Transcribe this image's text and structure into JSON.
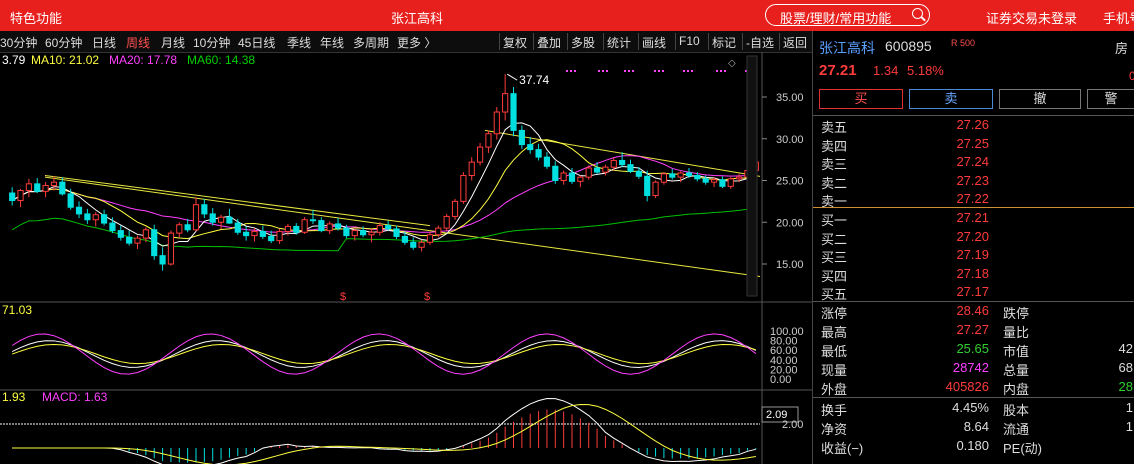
{
  "topbar": {
    "left_menu": "特色功能",
    "title": "张江高科",
    "search_placeholder": "股票/理财/常用功能",
    "login": "证券交易未登录",
    "mobile": "手机号"
  },
  "toolbar": {
    "periods": [
      "30分钟",
      "60分钟",
      "日线",
      "周线",
      "月线",
      "10分钟",
      "45日线",
      "季线",
      "年线",
      "多周期",
      "更多 〉"
    ],
    "active_period": "周线",
    "tools": [
      "复权",
      "叠加",
      "多股",
      "统计",
      "画线",
      "F10",
      "标记",
      "-自选",
      "返回"
    ]
  },
  "ma_legend": {
    "ma5": "3.79",
    "ma10": "MA10: 21.02",
    "ma20": "MA20: 17.78",
    "ma60": "MA60: 14.38"
  },
  "chart_data": {
    "type": "candlestick",
    "price_axis": [
      "35.00",
      "30.00",
      "25.00",
      "20.00",
      "15.00"
    ],
    "ylim": [
      12.5,
      37.74
    ],
    "peak_label": "37.74",
    "signal_marker": "$",
    "kdj_label": "71.03",
    "kdj_axis": [
      "100.00",
      "80.00",
      "60.00",
      "40.00",
      "20.00",
      "0.00"
    ],
    "macd_label_left": "1.93",
    "macd_label": "MACD: 1.63",
    "macd_axis_mark": "2.09",
    "macd_axis_tick": "2.00",
    "ohlc": [
      [
        23.5,
        24.2,
        22.0,
        22.6
      ],
      [
        22.6,
        24.0,
        21.8,
        23.8
      ],
      [
        23.8,
        25.2,
        23.0,
        24.6
      ],
      [
        24.6,
        25.3,
        23.5,
        23.7
      ],
      [
        23.7,
        24.8,
        23.0,
        24.4
      ],
      [
        24.4,
        25.5,
        23.8,
        24.8
      ],
      [
        24.8,
        25.4,
        23.2,
        23.4
      ],
      [
        23.4,
        24.0,
        21.5,
        21.8
      ],
      [
        21.8,
        22.5,
        20.5,
        21.0
      ],
      [
        21.0,
        21.6,
        19.8,
        20.3
      ],
      [
        20.3,
        21.2,
        19.5,
        20.9
      ],
      [
        20.9,
        21.5,
        19.6,
        19.9
      ],
      [
        19.9,
        20.6,
        18.7,
        19.0
      ],
      [
        19.0,
        19.6,
        17.8,
        18.2
      ],
      [
        18.2,
        19.0,
        17.2,
        17.5
      ],
      [
        17.5,
        18.4,
        16.8,
        18.1
      ],
      [
        18.1,
        19.4,
        17.6,
        19.1
      ],
      [
        19.1,
        19.7,
        15.5,
        16.0
      ],
      [
        16.0,
        17.0,
        14.2,
        15.0
      ],
      [
        15.0,
        19.0,
        14.8,
        18.7
      ],
      [
        18.7,
        20.0,
        18.2,
        19.7
      ],
      [
        19.7,
        20.4,
        18.8,
        19.1
      ],
      [
        19.1,
        23.0,
        18.9,
        22.1
      ],
      [
        22.1,
        22.8,
        20.5,
        21.0
      ],
      [
        21.0,
        21.7,
        19.6,
        20.0
      ],
      [
        20.0,
        20.9,
        19.2,
        20.6
      ],
      [
        20.6,
        21.6,
        19.8,
        19.9
      ],
      [
        19.9,
        20.4,
        18.5,
        18.8
      ],
      [
        18.8,
        19.5,
        17.8,
        18.4
      ],
      [
        18.4,
        19.3,
        17.7,
        18.9
      ],
      [
        18.9,
        19.6,
        18.0,
        18.3
      ],
      [
        18.3,
        19.0,
        17.5,
        17.8
      ],
      [
        17.8,
        19.2,
        17.4,
        18.9
      ],
      [
        18.9,
        19.8,
        18.4,
        19.5
      ],
      [
        19.5,
        19.9,
        18.5,
        18.8
      ],
      [
        18.8,
        20.6,
        18.6,
        20.3
      ],
      [
        20.3,
        21.5,
        19.8,
        20.2
      ],
      [
        20.2,
        20.6,
        18.8,
        19.0
      ],
      [
        19.0,
        20.1,
        18.6,
        19.8
      ],
      [
        19.8,
        20.5,
        19.0,
        19.3
      ],
      [
        19.3,
        19.7,
        18.1,
        18.4
      ],
      [
        18.4,
        19.3,
        17.8,
        19.0
      ],
      [
        19.0,
        19.5,
        18.2,
        18.5
      ],
      [
        18.5,
        19.2,
        17.6,
        18.8
      ],
      [
        18.8,
        20.0,
        18.4,
        19.6
      ],
      [
        19.6,
        20.2,
        19.0,
        19.2
      ],
      [
        19.2,
        19.6,
        18.0,
        18.3
      ],
      [
        18.3,
        18.9,
        17.3,
        17.6
      ],
      [
        17.6,
        18.2,
        16.7,
        17.0
      ],
      [
        17.0,
        17.9,
        16.5,
        17.6
      ],
      [
        17.6,
        18.8,
        17.3,
        18.5
      ],
      [
        18.5,
        19.6,
        18.2,
        19.3
      ],
      [
        19.3,
        21.0,
        19.0,
        20.7
      ],
      [
        20.7,
        22.8,
        20.3,
        22.5
      ],
      [
        22.5,
        26.0,
        22.2,
        25.6
      ],
      [
        25.6,
        27.8,
        25.0,
        27.2
      ],
      [
        27.2,
        29.5,
        26.8,
        29.0
      ],
      [
        29.0,
        31.0,
        28.3,
        30.6
      ],
      [
        30.6,
        33.8,
        29.9,
        33.2
      ],
      [
        33.2,
        37.74,
        32.2,
        35.4
      ],
      [
        35.4,
        36.2,
        30.3,
        31.0
      ],
      [
        31.0,
        31.6,
        28.8,
        29.3
      ],
      [
        29.3,
        30.2,
        28.2,
        28.7
      ],
      [
        28.7,
        29.4,
        27.4,
        27.8
      ],
      [
        27.8,
        28.4,
        26.4,
        26.7
      ],
      [
        26.7,
        27.3,
        24.6,
        25.0
      ],
      [
        25.0,
        26.2,
        24.5,
        25.9
      ],
      [
        25.9,
        26.5,
        24.6,
        24.9
      ],
      [
        24.9,
        25.6,
        24.2,
        25.4
      ],
      [
        25.4,
        26.8,
        25.1,
        26.5
      ],
      [
        26.5,
        27.2,
        25.8,
        26.0
      ],
      [
        26.0,
        26.9,
        25.6,
        26.6
      ],
      [
        26.6,
        27.7,
        26.2,
        27.4
      ],
      [
        27.4,
        28.4,
        26.6,
        26.9
      ],
      [
        26.9,
        27.5,
        25.9,
        26.1
      ],
      [
        26.1,
        26.6,
        25.2,
        25.5
      ],
      [
        25.5,
        26.2,
        22.5,
        23.2
      ],
      [
        23.2,
        25.0,
        22.9,
        24.8
      ],
      [
        24.8,
        26.0,
        24.5,
        25.8
      ],
      [
        25.8,
        26.4,
        25.1,
        25.4
      ],
      [
        25.4,
        26.1,
        24.8,
        25.9
      ],
      [
        25.9,
        26.5,
        25.3,
        25.6
      ],
      [
        25.6,
        26.0,
        24.9,
        25.2
      ],
      [
        25.2,
        25.6,
        24.5,
        24.8
      ],
      [
        24.8,
        25.4,
        24.2,
        25.1
      ],
      [
        25.1,
        25.5,
        24.1,
        24.3
      ],
      [
        24.3,
        25.4,
        24.0,
        25.2
      ],
      [
        25.2,
        25.8,
        24.8,
        25.4
      ],
      [
        25.4,
        26.5,
        25.2,
        26.2
      ],
      [
        26.2,
        27.4,
        26.0,
        27.21
      ]
    ]
  },
  "quote": {
    "name": "张江高科",
    "code": "600895",
    "tag": "R 500",
    "extra": "房",
    "price": "27.21",
    "change": "1.34",
    "percent": "5.18%",
    "zero": "0"
  },
  "trade_buttons": {
    "buy": "买",
    "sell": "卖",
    "cancel": "撤",
    "more": "警"
  },
  "order_book": {
    "sells": [
      {
        "label": "卖五",
        "price": "27.26"
      },
      {
        "label": "卖四",
        "price": "27.25"
      },
      {
        "label": "卖三",
        "price": "27.24"
      },
      {
        "label": "卖二",
        "price": "27.23"
      },
      {
        "label": "卖一",
        "price": "27.22"
      }
    ],
    "buys": [
      {
        "label": "买一",
        "price": "27.21"
      },
      {
        "label": "买二",
        "price": "27.20"
      },
      {
        "label": "买三",
        "price": "27.19"
      },
      {
        "label": "买四",
        "price": "27.18"
      },
      {
        "label": "买五",
        "price": "27.17"
      }
    ]
  },
  "stats": [
    {
      "k": "涨停",
      "v": "28.46",
      "k2": "跌停",
      "v2": ""
    },
    {
      "k": "最高",
      "v": "27.27",
      "k2": "量比",
      "v2": ""
    },
    {
      "k": "最低",
      "v": "25.65",
      "k2": "市值",
      "v2": "42"
    },
    {
      "k": "现量",
      "v": "28742",
      "k2": "总量",
      "v2": "68"
    },
    {
      "k": "外盘",
      "v": "405826",
      "k2": "内盘",
      "v2": "28"
    },
    {
      "k": "换手",
      "v": "4.45%",
      "k2": "股本",
      "v2": "1"
    },
    {
      "k": "净资",
      "v": "8.64",
      "k2": "流通",
      "v2": "1"
    },
    {
      "k": "收益(−)",
      "v": "0.180",
      "k2": "PE(动)",
      "v2": ""
    }
  ],
  "colors": {
    "up": "#ff3b3b",
    "down": "#00e0e0",
    "ma5": "#ffffff",
    "ma10": "#ffff40",
    "ma20": "#ff40ff",
    "ma60": "#00c000",
    "volume_down": "#00c000"
  }
}
